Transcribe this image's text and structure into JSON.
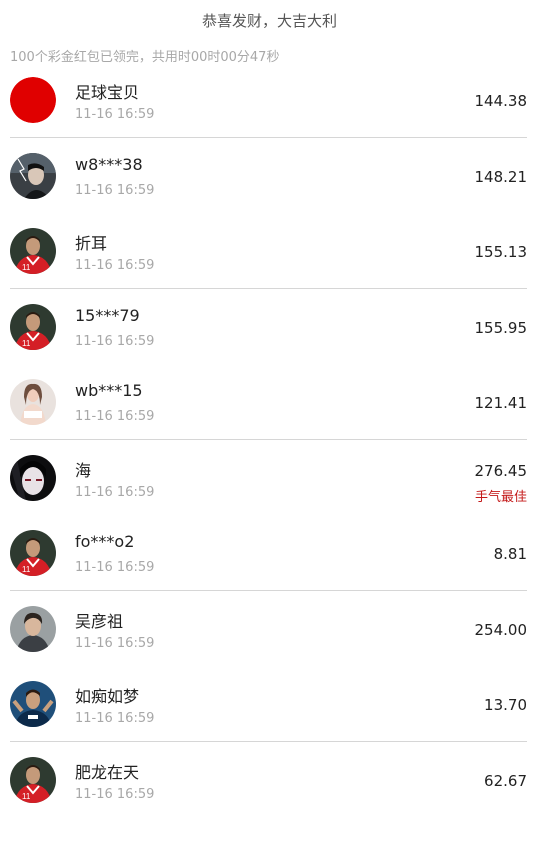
{
  "header": {
    "blessing": "恭喜发财，大吉大利",
    "summary": "100个彩金红包已领完，共用时00时00分47秒"
  },
  "colors": {
    "accent_red": "#c41a1a",
    "divider": "#d6d6d6",
    "secondary_text": "#a8a8a8"
  },
  "records": [
    {
      "name": "足球宝贝",
      "time": "11-16 16:59",
      "amount": "144.38",
      "avatar": "red-circle-avatar"
    },
    {
      "name": "w8***38",
      "time": "11-16 16:59",
      "amount": "148.21",
      "avatar": "dark-portrait-avatar"
    },
    {
      "name": "折耳",
      "time": "11-16 16:59",
      "amount": "155.13",
      "avatar": "soccer-player-avatar"
    },
    {
      "name": "15***79",
      "time": "11-16 16:59",
      "amount": "155.95",
      "avatar": "soccer-player-avatar"
    },
    {
      "name": "wb***15",
      "time": "11-16 16:59",
      "amount": "121.41",
      "avatar": "woman-portrait-avatar"
    },
    {
      "name": "海",
      "time": "11-16 16:59",
      "amount": "276.45",
      "best_label": "手气最佳",
      "avatar": "dark-face-avatar"
    },
    {
      "name": "fo***o2",
      "time": "11-16 16:59",
      "amount": "8.81",
      "avatar": "soccer-player-avatar"
    },
    {
      "name": "吴彦祖",
      "time": "11-16 16:59",
      "amount": "254.00",
      "avatar": "man-portrait-avatar"
    },
    {
      "name": "如痴如梦",
      "time": "11-16 16:59",
      "amount": "13.70",
      "avatar": "blue-jersey-player-avatar"
    },
    {
      "name": "肥龙在天",
      "time": "11-16 16:59",
      "amount": "62.67",
      "avatar": "soccer-player-avatar"
    }
  ]
}
